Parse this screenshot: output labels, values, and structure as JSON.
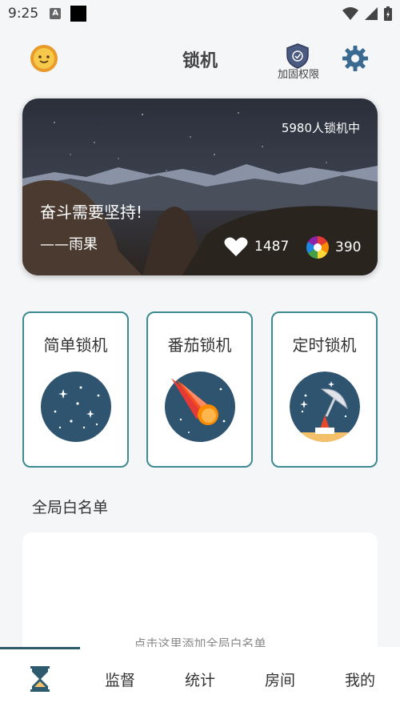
{
  "status_bar": {
    "time": "9:25"
  },
  "header": {
    "title": "锁机",
    "shield_label": "加固权限"
  },
  "banner": {
    "lock_count_text": "5980人锁机中",
    "quote": "奋斗需要坚持!",
    "author": "——雨果",
    "likes": "1487",
    "views": "390"
  },
  "modes": [
    {
      "label": "简单锁机",
      "icon": "starry-night-icon"
    },
    {
      "label": "番茄锁机",
      "icon": "comet-icon"
    },
    {
      "label": "定时锁机",
      "icon": "radar-dish-icon"
    }
  ],
  "whitelist": {
    "title": "全局白名单",
    "hint": "点击这里添加全局白名单"
  },
  "bottom_nav": {
    "items": [
      "监督",
      "统计",
      "房间",
      "我的"
    ],
    "active_icon": "hourglass-icon"
  },
  "colors": {
    "accent": "#3d8a90",
    "icon_circle": "#2e5470",
    "page_bg": "#f5f6f8"
  }
}
